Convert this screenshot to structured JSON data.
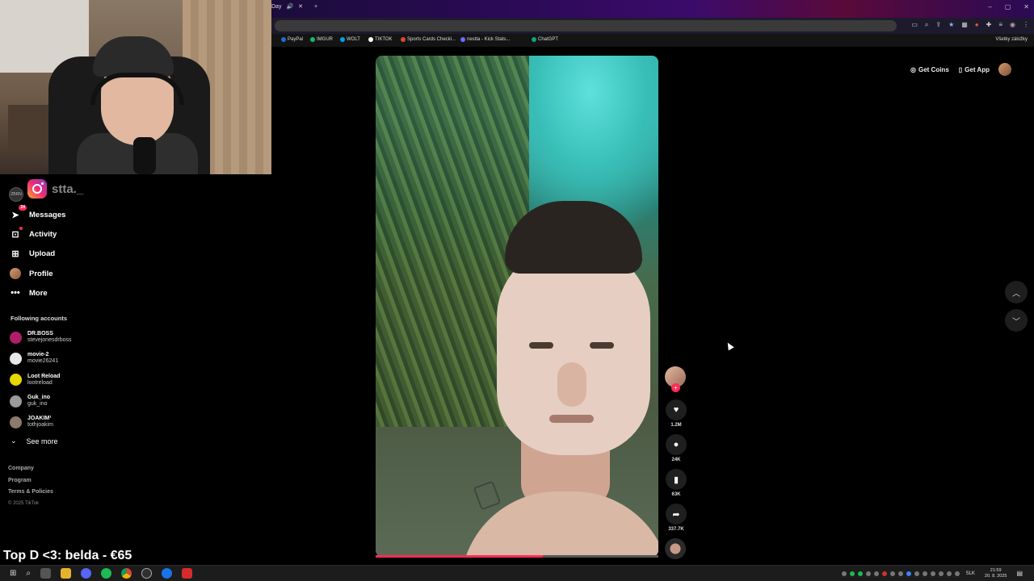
{
  "browser": {
    "tab_title": "Day",
    "bookmarks": [
      {
        "label": "PayPal",
        "color": "#1f6fd1"
      },
      {
        "label": "IMGUR",
        "color": "#1bb76e"
      },
      {
        "label": "WOLT",
        "color": "#00a2e8"
      },
      {
        "label": "TIKTOK",
        "color": "#ffffff"
      },
      {
        "label": "Sports Cards Checkl...",
        "color": "#e0492b"
      },
      {
        "label": "nestta - Kick Stats...",
        "color": "#6c6cff"
      },
      {
        "label": "ChatGPT",
        "color": "#10a37f"
      }
    ],
    "all_bookmarks": "Všetky záložky"
  },
  "sidebar": {
    "brand": "stta._",
    "nav": [
      {
        "label": "Messages",
        "icon": "paper-plane-icon",
        "badge": "24"
      },
      {
        "label": "Activity",
        "icon": "inbox-icon",
        "badge": ""
      },
      {
        "label": "Upload",
        "icon": "plus-square-icon",
        "badge": ""
      },
      {
        "label": "Profile",
        "icon": "avatar",
        "badge": ""
      },
      {
        "label": "More",
        "icon": "ellipsis-icon",
        "badge": ""
      }
    ],
    "following_title": "Following accounts",
    "following": [
      {
        "name": "DR.BOSS",
        "user": "stevejonesdrboss",
        "color": "#b01e6a"
      },
      {
        "name": "movie-2",
        "user": "movie26241",
        "color": "#e8e8e8"
      },
      {
        "name": "Loot Reload",
        "user": "lootreload",
        "color": "#e8d600"
      },
      {
        "name": "Guk_ino",
        "user": "guk_ino",
        "color": "#9a9a9a"
      },
      {
        "name": "JOAKIM¹",
        "user": "tothjoakim",
        "color": "#8c7a6a"
      }
    ],
    "see_more": "See more",
    "footer": [
      "Company",
      "Program",
      "Terms & Policies"
    ],
    "copyright": "© 2025 TikTok"
  },
  "header": {
    "get_coins": "Get Coins",
    "get_app": "Get App"
  },
  "video": {
    "progress": 0.59,
    "likes": "1.2M",
    "comments": "24K",
    "saves": "63K",
    "shares": "337.7K"
  },
  "stream_overlay": "Top D <3: belda - €65",
  "taskbar": {
    "time": "21:59",
    "date": "20. 8. 2025",
    "lang": "SLK"
  },
  "colors": {
    "accent": "#fe2c55",
    "background": "#000000"
  }
}
